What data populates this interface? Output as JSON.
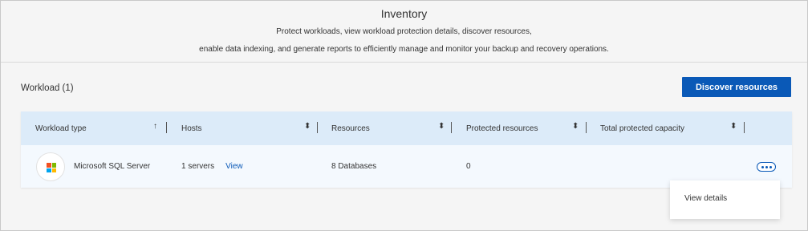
{
  "header": {
    "title": "Inventory",
    "description_line1": "Protect workloads, view workload protection details, discover resources,",
    "description_line2": "enable data indexing, and generate reports to efficiently manage and monitor your backup and recovery operations."
  },
  "workload_section": {
    "label": "Workload (1)",
    "discover_button": "Discover resources"
  },
  "table": {
    "columns": [
      {
        "label": "Workload type",
        "sort_glyph": "↑"
      },
      {
        "label": "Hosts",
        "sort_glyph": "⬍"
      },
      {
        "label": "Resources",
        "sort_glyph": "⬍"
      },
      {
        "label": "Protected resources",
        "sort_glyph": "⬍"
      },
      {
        "label": "Total protected capacity",
        "sort_glyph": "⬍"
      }
    ],
    "rows": [
      {
        "icon": "microsoft-logo-icon",
        "workload_type": "Microsoft SQL Server",
        "hosts": "1 servers",
        "hosts_link": "View",
        "resources": "8 Databases",
        "protected_resources": "0",
        "total_protected_capacity": ""
      }
    ]
  },
  "row_menu": {
    "items": [
      "View details"
    ]
  },
  "colors": {
    "accent": "#0a59b7",
    "header_bg": "#dcebf9",
    "row_bg": "#f4f9fe",
    "page_bg": "#f5f5f5"
  }
}
